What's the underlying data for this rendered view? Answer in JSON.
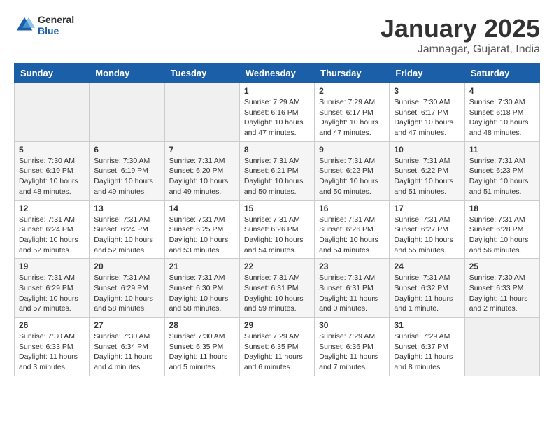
{
  "header": {
    "logo_general": "General",
    "logo_blue": "Blue",
    "month_title": "January 2025",
    "subtitle": "Jamnagar, Gujarat, India"
  },
  "days_of_week": [
    "Sunday",
    "Monday",
    "Tuesday",
    "Wednesday",
    "Thursday",
    "Friday",
    "Saturday"
  ],
  "weeks": [
    [
      {
        "day": "",
        "info": ""
      },
      {
        "day": "",
        "info": ""
      },
      {
        "day": "",
        "info": ""
      },
      {
        "day": "1",
        "info": "Sunrise: 7:29 AM\nSunset: 6:16 PM\nDaylight: 10 hours\nand 47 minutes."
      },
      {
        "day": "2",
        "info": "Sunrise: 7:29 AM\nSunset: 6:17 PM\nDaylight: 10 hours\nand 47 minutes."
      },
      {
        "day": "3",
        "info": "Sunrise: 7:30 AM\nSunset: 6:17 PM\nDaylight: 10 hours\nand 47 minutes."
      },
      {
        "day": "4",
        "info": "Sunrise: 7:30 AM\nSunset: 6:18 PM\nDaylight: 10 hours\nand 48 minutes."
      }
    ],
    [
      {
        "day": "5",
        "info": "Sunrise: 7:30 AM\nSunset: 6:19 PM\nDaylight: 10 hours\nand 48 minutes."
      },
      {
        "day": "6",
        "info": "Sunrise: 7:30 AM\nSunset: 6:19 PM\nDaylight: 10 hours\nand 49 minutes."
      },
      {
        "day": "7",
        "info": "Sunrise: 7:31 AM\nSunset: 6:20 PM\nDaylight: 10 hours\nand 49 minutes."
      },
      {
        "day": "8",
        "info": "Sunrise: 7:31 AM\nSunset: 6:21 PM\nDaylight: 10 hours\nand 50 minutes."
      },
      {
        "day": "9",
        "info": "Sunrise: 7:31 AM\nSunset: 6:22 PM\nDaylight: 10 hours\nand 50 minutes."
      },
      {
        "day": "10",
        "info": "Sunrise: 7:31 AM\nSunset: 6:22 PM\nDaylight: 10 hours\nand 51 minutes."
      },
      {
        "day": "11",
        "info": "Sunrise: 7:31 AM\nSunset: 6:23 PM\nDaylight: 10 hours\nand 51 minutes."
      }
    ],
    [
      {
        "day": "12",
        "info": "Sunrise: 7:31 AM\nSunset: 6:24 PM\nDaylight: 10 hours\nand 52 minutes."
      },
      {
        "day": "13",
        "info": "Sunrise: 7:31 AM\nSunset: 6:24 PM\nDaylight: 10 hours\nand 52 minutes."
      },
      {
        "day": "14",
        "info": "Sunrise: 7:31 AM\nSunset: 6:25 PM\nDaylight: 10 hours\nand 53 minutes."
      },
      {
        "day": "15",
        "info": "Sunrise: 7:31 AM\nSunset: 6:26 PM\nDaylight: 10 hours\nand 54 minutes."
      },
      {
        "day": "16",
        "info": "Sunrise: 7:31 AM\nSunset: 6:26 PM\nDaylight: 10 hours\nand 54 minutes."
      },
      {
        "day": "17",
        "info": "Sunrise: 7:31 AM\nSunset: 6:27 PM\nDaylight: 10 hours\nand 55 minutes."
      },
      {
        "day": "18",
        "info": "Sunrise: 7:31 AM\nSunset: 6:28 PM\nDaylight: 10 hours\nand 56 minutes."
      }
    ],
    [
      {
        "day": "19",
        "info": "Sunrise: 7:31 AM\nSunset: 6:29 PM\nDaylight: 10 hours\nand 57 minutes."
      },
      {
        "day": "20",
        "info": "Sunrise: 7:31 AM\nSunset: 6:29 PM\nDaylight: 10 hours\nand 58 minutes."
      },
      {
        "day": "21",
        "info": "Sunrise: 7:31 AM\nSunset: 6:30 PM\nDaylight: 10 hours\nand 58 minutes."
      },
      {
        "day": "22",
        "info": "Sunrise: 7:31 AM\nSunset: 6:31 PM\nDaylight: 10 hours\nand 59 minutes."
      },
      {
        "day": "23",
        "info": "Sunrise: 7:31 AM\nSunset: 6:31 PM\nDaylight: 11 hours\nand 0 minutes."
      },
      {
        "day": "24",
        "info": "Sunrise: 7:31 AM\nSunset: 6:32 PM\nDaylight: 11 hours\nand 1 minute."
      },
      {
        "day": "25",
        "info": "Sunrise: 7:30 AM\nSunset: 6:33 PM\nDaylight: 11 hours\nand 2 minutes."
      }
    ],
    [
      {
        "day": "26",
        "info": "Sunrise: 7:30 AM\nSunset: 6:33 PM\nDaylight: 11 hours\nand 3 minutes."
      },
      {
        "day": "27",
        "info": "Sunrise: 7:30 AM\nSunset: 6:34 PM\nDaylight: 11 hours\nand 4 minutes."
      },
      {
        "day": "28",
        "info": "Sunrise: 7:30 AM\nSunset: 6:35 PM\nDaylight: 11 hours\nand 5 minutes."
      },
      {
        "day": "29",
        "info": "Sunrise: 7:29 AM\nSunset: 6:35 PM\nDaylight: 11 hours\nand 6 minutes."
      },
      {
        "day": "30",
        "info": "Sunrise: 7:29 AM\nSunset: 6:36 PM\nDaylight: 11 hours\nand 7 minutes."
      },
      {
        "day": "31",
        "info": "Sunrise: 7:29 AM\nSunset: 6:37 PM\nDaylight: 11 hours\nand 8 minutes."
      },
      {
        "day": "",
        "info": ""
      }
    ]
  ]
}
